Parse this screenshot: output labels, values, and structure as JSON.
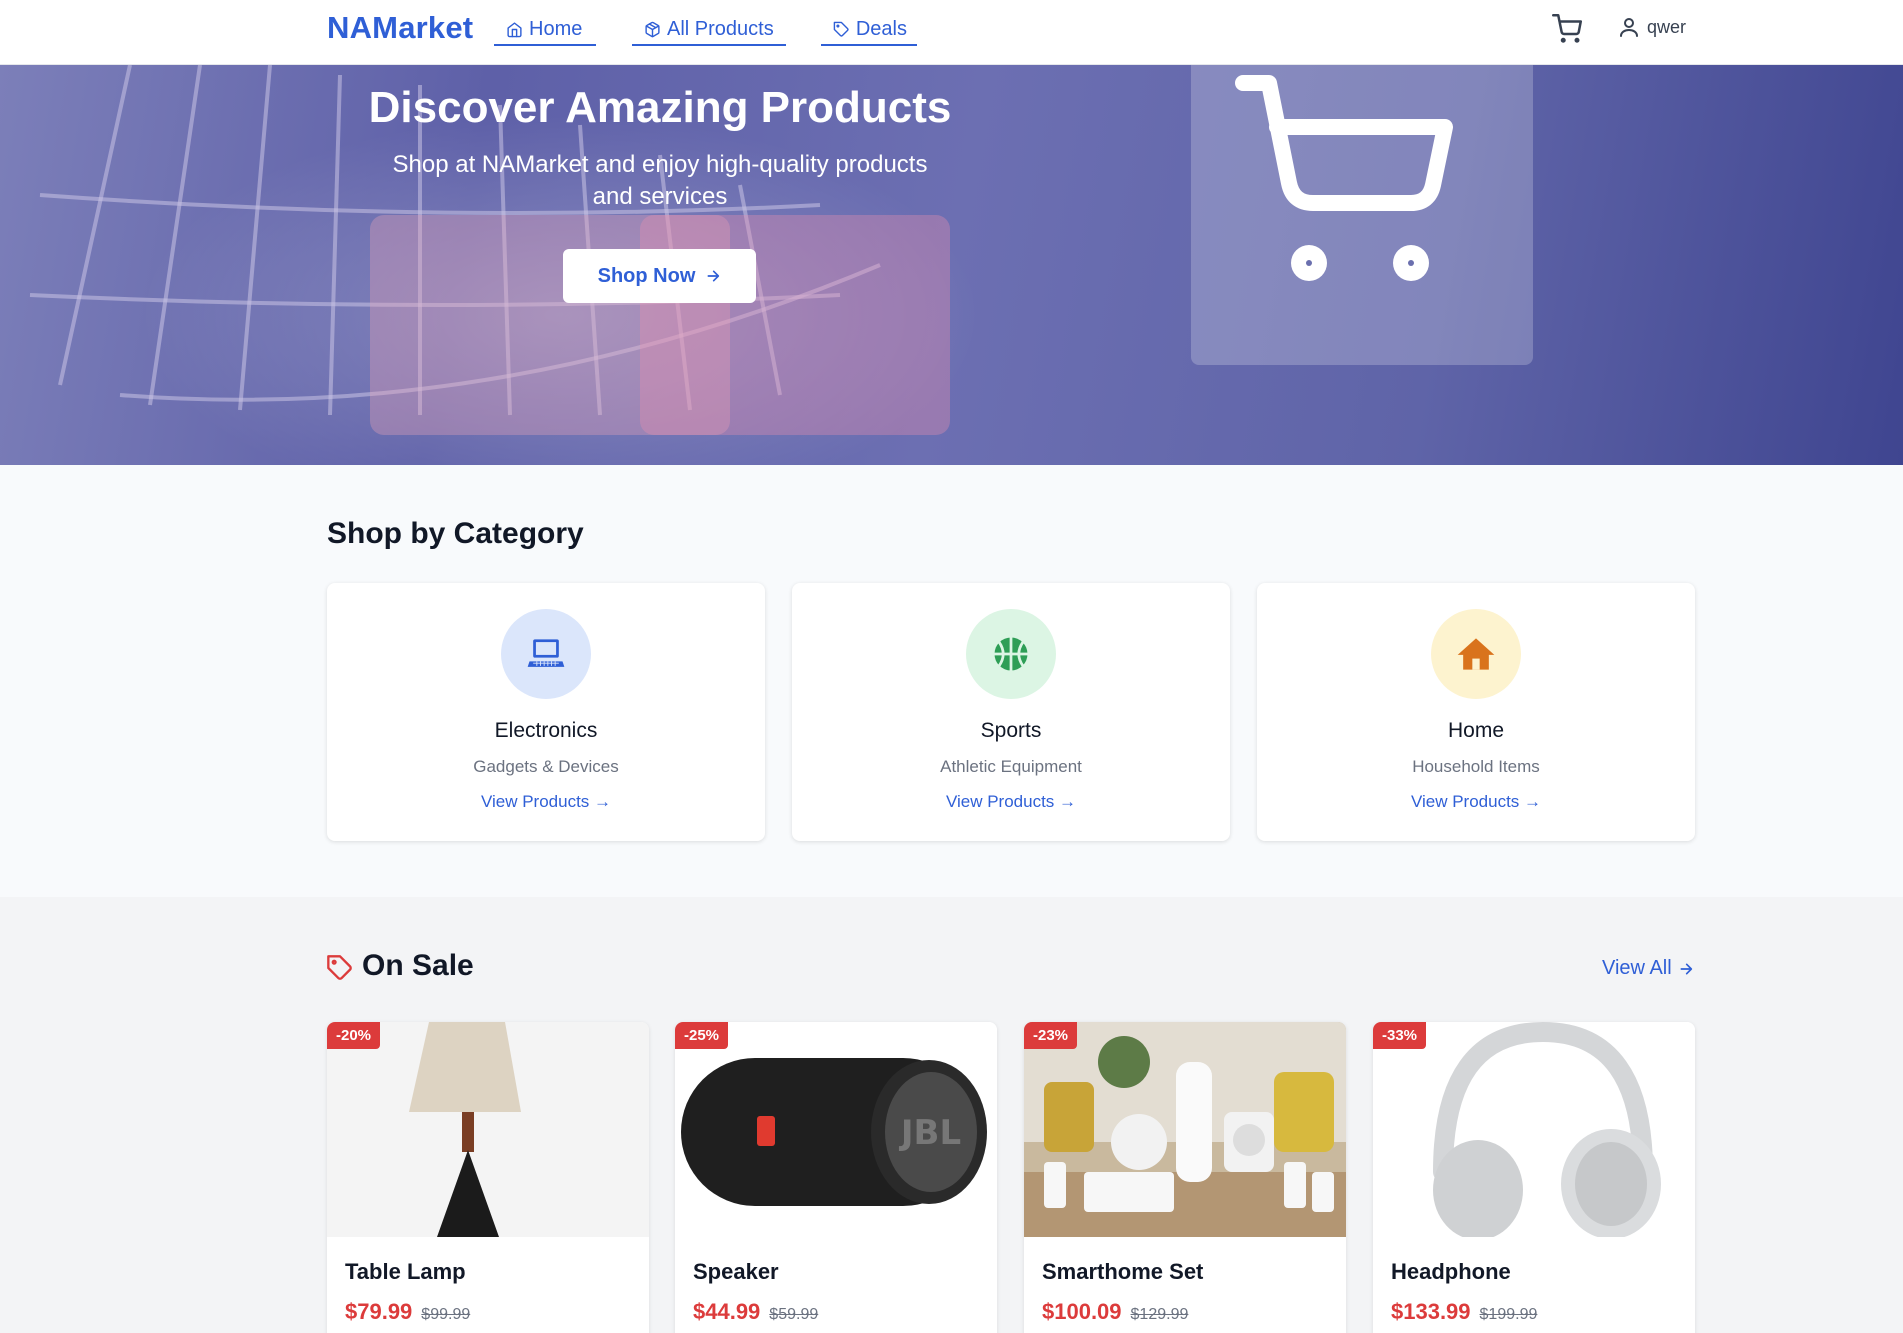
{
  "nav": {
    "brand": "NAMarket",
    "links": [
      {
        "label": "Home",
        "icon": "home-icon"
      },
      {
        "label": "All Products",
        "icon": "box-icon"
      },
      {
        "label": "Deals",
        "icon": "tag-icon"
      }
    ],
    "user_name": "qwer",
    "accent": "#2f5fd6"
  },
  "hero": {
    "title": "Discover Amazing Products",
    "subtitle": "Shop at NAMarket and enjoy high-quality products and services",
    "cta_label": "Shop Now"
  },
  "categories": {
    "title": "Shop by Category",
    "items": [
      {
        "name": "Electronics",
        "desc": "Gadgets & Devices",
        "link": "View Products →",
        "icon": "laptop-icon",
        "color": "#2f5fd6"
      },
      {
        "name": "Sports",
        "desc": "Athletic Equipment",
        "link": "View Products →",
        "icon": "basketball-icon",
        "color": "#2e9e56"
      },
      {
        "name": "Home",
        "desc": "Household Items",
        "link": "View Products →",
        "icon": "house-icon",
        "color": "#d9731c"
      }
    ]
  },
  "sale": {
    "title": "On Sale",
    "view_all": "View All",
    "products": [
      {
        "name": "Table Lamp",
        "price": "$79.99",
        "old_price": "$99.99",
        "discount": "-20%"
      },
      {
        "name": "Speaker",
        "price": "$44.99",
        "old_price": "$59.99",
        "discount": "-25%"
      },
      {
        "name": "Smarthome Set",
        "price": "$100.09",
        "old_price": "$129.99",
        "discount": "-23%"
      },
      {
        "name": "Headphone",
        "price": "$133.99",
        "old_price": "$199.99",
        "discount": "-33%"
      }
    ],
    "sale_color": "#dc3b3b"
  }
}
